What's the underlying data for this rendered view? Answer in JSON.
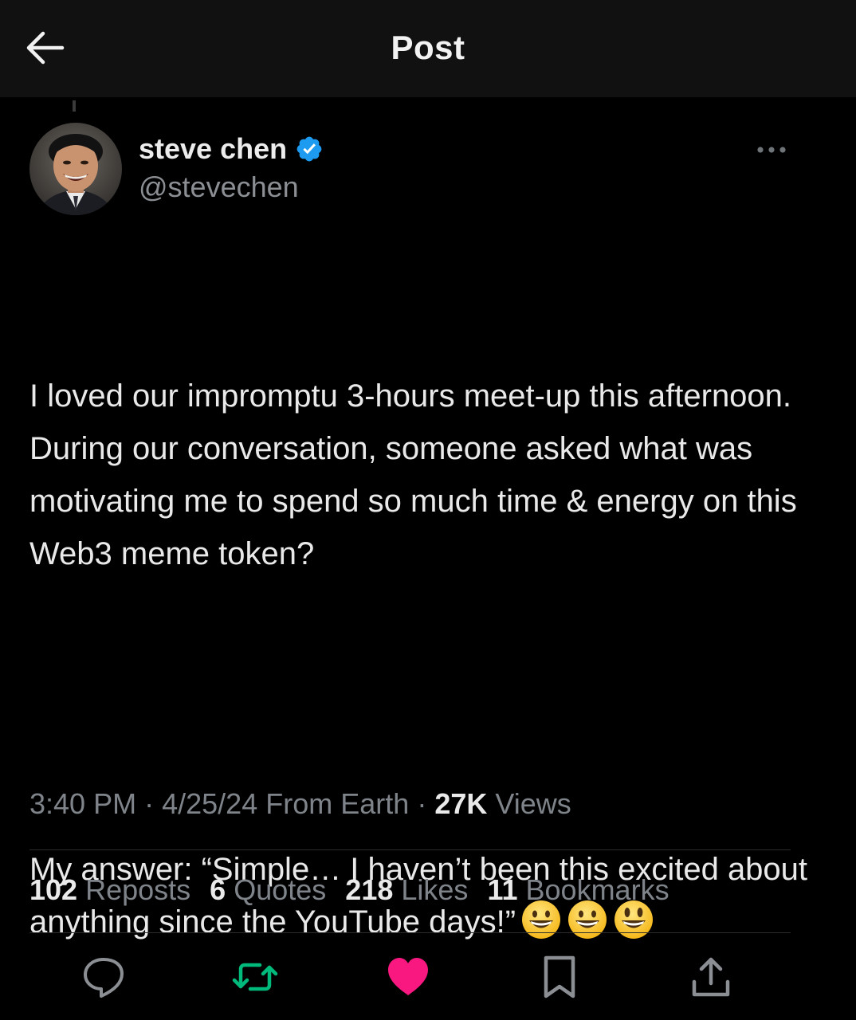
{
  "header": {
    "title": "Post"
  },
  "author": {
    "display_name": "steve chen",
    "handle": "@stevechen",
    "verified": true
  },
  "post": {
    "paragraph1": "I loved our impromptu 3-hours meet-up this afternoon.  During our conversation, someone asked what was motivating me to spend so much time & energy on this Web3 meme token?",
    "paragraph2": "My answer: “Simple… I haven’t been this excited about anything since the YouTube days!”",
    "emojis": [
      "grinning-face",
      "grinning-face",
      "smiling-face-big-eyes"
    ]
  },
  "meta": {
    "time": "3:40 PM",
    "date": "4/25/24",
    "source": "From Earth",
    "views_count": "27K",
    "views_label": "Views",
    "separator": "·"
  },
  "stats": [
    {
      "count": "102",
      "label": "Reposts"
    },
    {
      "count": "6",
      "label": "Quotes"
    },
    {
      "count": "218",
      "label": "Likes"
    },
    {
      "count": "11",
      "label": "Bookmarks"
    }
  ],
  "actions": [
    {
      "name": "reply",
      "icon": "speech-bubble-icon",
      "color": "#8b8f94"
    },
    {
      "name": "repost",
      "icon": "repost-icon",
      "color": "#00ba7c"
    },
    {
      "name": "like",
      "icon": "heart-icon",
      "color": "#f91880"
    },
    {
      "name": "bookmark",
      "icon": "bookmark-icon",
      "color": "#8b8f94"
    },
    {
      "name": "share",
      "icon": "share-icon",
      "color": "#8b8f94"
    }
  ],
  "colors": {
    "background": "#000000",
    "header_background": "#111111",
    "verified_blue": "#1d9bf0",
    "muted_text": "#7f848a"
  }
}
